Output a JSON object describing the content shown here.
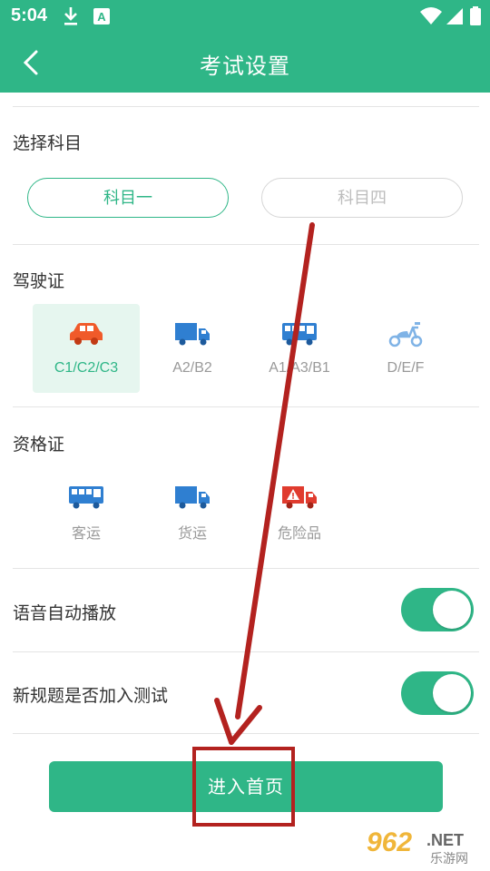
{
  "status_bar": {
    "time": "5:04",
    "icons": [
      "download-icon",
      "a-notification-icon",
      "wifi-icon",
      "signal-icon",
      "battery-icon"
    ]
  },
  "app_bar": {
    "title": "考试设置",
    "back_icon": "back-arrow-icon"
  },
  "subject_section": {
    "title": "选择科目",
    "options": [
      {
        "label": "科目一",
        "selected": true
      },
      {
        "label": "科目四",
        "selected": false
      }
    ]
  },
  "license_section": {
    "title": "驾驶证",
    "items": [
      {
        "label": "C1/C2/C3",
        "icon": "car-icon",
        "selected": true
      },
      {
        "label": "A2/B2",
        "icon": "truck-icon",
        "selected": false
      },
      {
        "label": "A1/A3/B1",
        "icon": "bus-icon",
        "selected": false
      },
      {
        "label": "D/E/F",
        "icon": "scooter-icon",
        "selected": false
      }
    ]
  },
  "qualification_section": {
    "title": "资格证",
    "items": [
      {
        "label": "客运",
        "icon": "bus-icon"
      },
      {
        "label": "货运",
        "icon": "truck-icon"
      },
      {
        "label": "危险品",
        "icon": "hazard-truck-icon"
      }
    ]
  },
  "settings": [
    {
      "label": "语音自动播放",
      "enabled": true
    },
    {
      "label": "新规题是否加入测试",
      "enabled": true
    }
  ],
  "enter_button": {
    "label": "进入首页"
  },
  "colors": {
    "primary": "#2fb687",
    "selected_bg": "#e6f6ef",
    "car_orange": "#f05a2a",
    "vehicle_blue": "#2f7fd1",
    "hazard_red": "#e03b2e",
    "annotation_red": "#b3221f"
  },
  "watermark": {
    "number": "962",
    "suffix": ".NET",
    "subtitle": "乐游网"
  }
}
